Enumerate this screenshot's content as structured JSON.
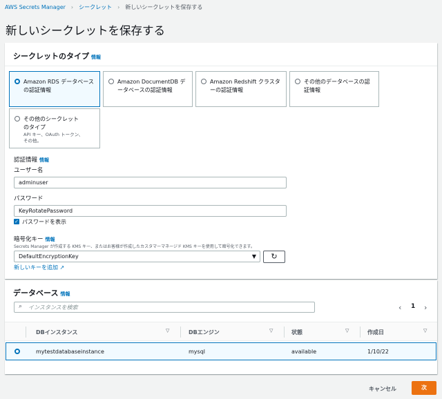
{
  "breadcrumb": {
    "items": [
      "AWS Secrets Manager",
      "シークレット"
    ],
    "current": "新しいシークレットを保存する"
  },
  "page_title": "新しいシークレットを保存する",
  "secret_type": {
    "title": "シークレットのタイプ",
    "info": "情報",
    "tiles": [
      {
        "label": "Amazon RDS データベースの認証情報",
        "selected": true
      },
      {
        "label": "Amazon DocumentDB データベースの認証情報",
        "selected": false
      },
      {
        "label": "Amazon Redshift クラスターの認証情報",
        "selected": false
      },
      {
        "label": "その他のデータベースの認証情報",
        "selected": false
      },
      {
        "label": "その他のシークレットのタイプ",
        "desc": "API キー、OAuth トークン、その他。",
        "selected": false
      }
    ]
  },
  "credentials": {
    "title": "認証情報",
    "info": "情報",
    "username_label": "ユーザー名",
    "username_value": "adminuser",
    "password_label": "パスワード",
    "password_value": "KeyRotatePassword",
    "show_password_label": "パスワードを表示",
    "show_password_checked": true
  },
  "encryption": {
    "title": "暗号化キー",
    "info": "情報",
    "description": "Secrets Manager が作成する KMS キー、またはお客様が作成したカスタマーマネージド KMS キーを使用して暗号化できます。",
    "selected_key": "DefaultEncryptionKey",
    "add_new_key": "新しいキーを追加"
  },
  "database": {
    "title": "データベース",
    "info": "情報",
    "search_placeholder": "インスタンスを検索",
    "page": "1",
    "columns": [
      "DBインスタンス",
      "DBエンジン",
      "状態",
      "作成日"
    ],
    "rows": [
      {
        "instance": "mytestdatabaseinstance",
        "engine": "mysql",
        "status": "available",
        "created": "1/10/22",
        "selected": true
      }
    ]
  },
  "footer": {
    "cancel_label": "キャンセル",
    "next_label": "次"
  },
  "colors": {
    "accent": "#0073bb",
    "primary_button": "#ec7211"
  }
}
